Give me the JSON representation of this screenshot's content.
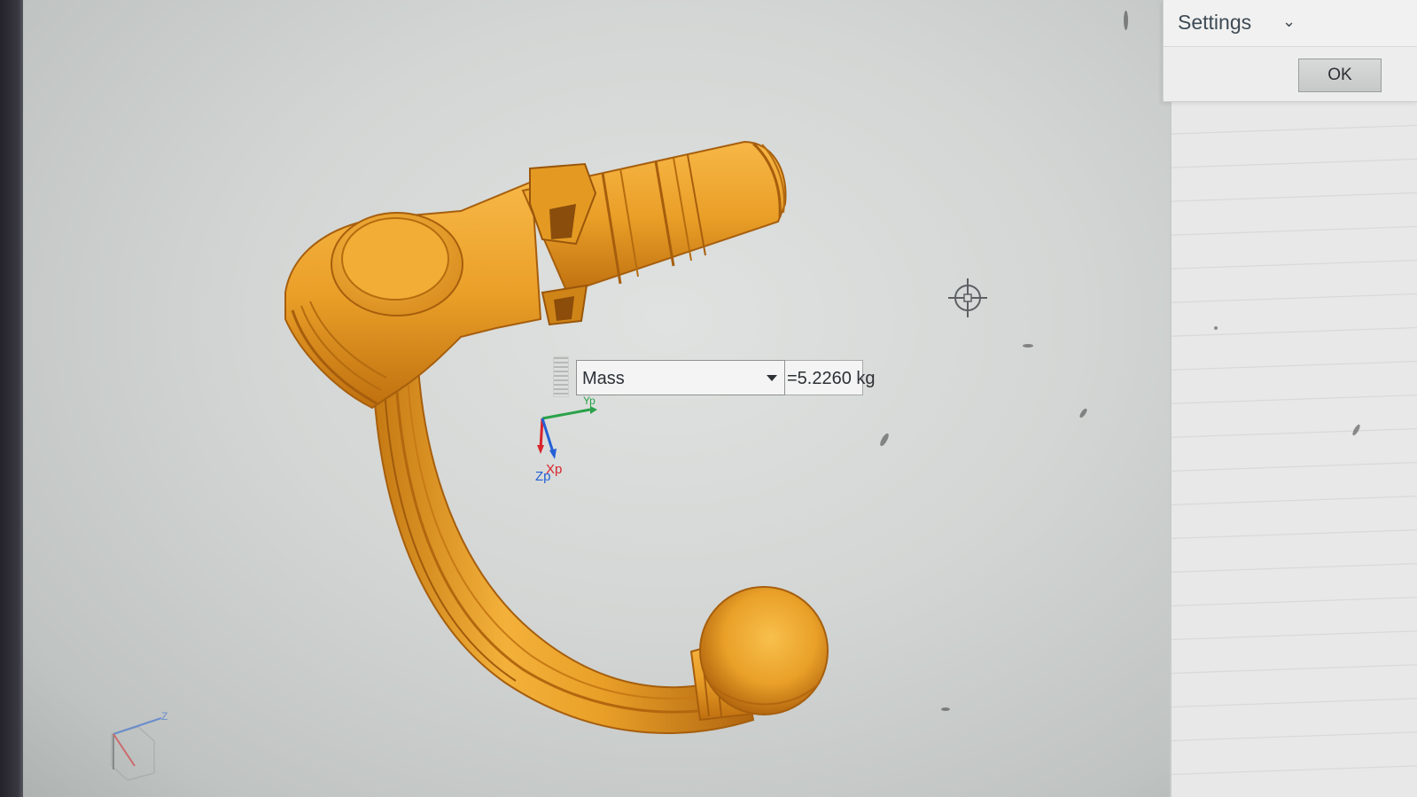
{
  "settings_dialog": {
    "title": "Settings",
    "ok_label": "OK"
  },
  "mass_readout": {
    "property": "Mass",
    "value": "=5.2260 kg"
  },
  "triad": {
    "axis_x_label": "Xp",
    "axis_z_label": "Zp",
    "axis_y_label": "Yp"
  },
  "view_triad": {
    "axis_label": "Z"
  },
  "colors": {
    "model": "#e8a22c",
    "model_shadow": "#b86e12",
    "viewport": "#d6d9d7",
    "axis_x": "#d8242c",
    "axis_y": "#2aa14a",
    "axis_z": "#2460d6"
  }
}
